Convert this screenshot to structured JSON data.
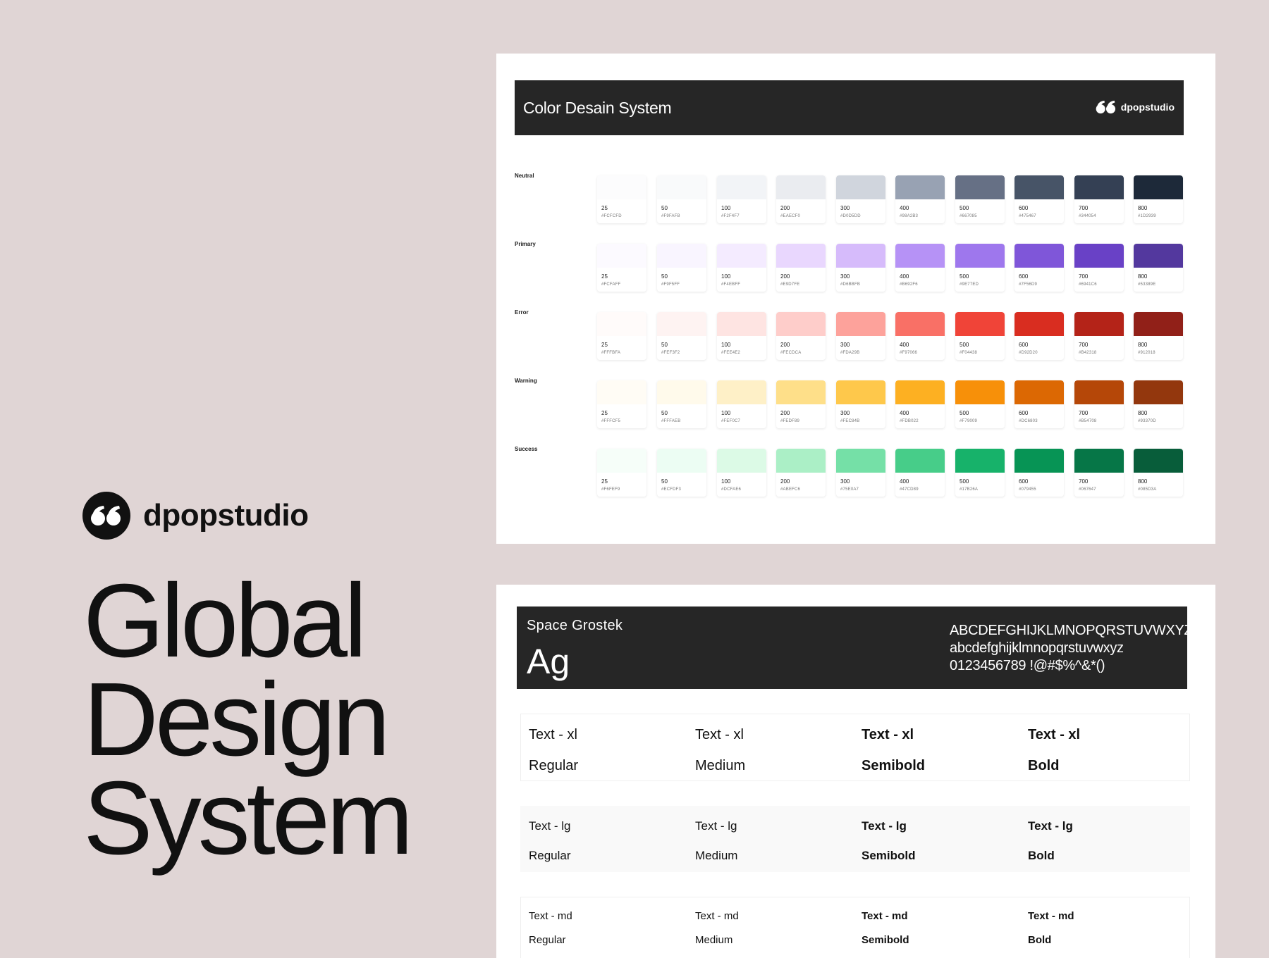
{
  "brand": {
    "name": "dpopstudio"
  },
  "hero": {
    "line1": "Global",
    "line2": "Design",
    "line3": "System"
  },
  "color_system": {
    "title": "Color Desain System",
    "brand_label": "dpopstudio",
    "steps": [
      "25",
      "50",
      "100",
      "200",
      "300",
      "400",
      "500",
      "600",
      "700",
      "800"
    ],
    "rows": [
      {
        "label": "Neutral",
        "hex_labels": [
          "#FCFCFD",
          "#F9FAFB",
          "#F2F4F7",
          "#EAECF0",
          "#D0D5DD",
          "#98A2B3",
          "#667085",
          "#475467",
          "#344054",
          "#1D2939"
        ],
        "colors": [
          "#FCFCFD",
          "#F9FAFB",
          "#F2F4F7",
          "#EAECF0",
          "#D0D5DD",
          "#98A2B3",
          "#667085",
          "#475467",
          "#344054",
          "#1D2939"
        ]
      },
      {
        "label": "Primary",
        "hex_labels": [
          "#FCFAFF",
          "#F9F5FF",
          "#F4EBFF",
          "#E9D7FE",
          "#D6BBFB",
          "#B692F6",
          "#9E77ED",
          "#7F56D9",
          "#6941C6",
          "#53389E"
        ],
        "colors": [
          "#FCFAFF",
          "#F9F5FF",
          "#F4EBFF",
          "#E9D7FE",
          "#D6BBFB",
          "#B692F6",
          "#9E77ED",
          "#7F56D9",
          "#6941C6",
          "#53389E"
        ]
      },
      {
        "label": "Error",
        "hex_labels": [
          "#FFFBFA",
          "#FEF3F2",
          "#FEE4E2",
          "#FECDCA",
          "#FDA29B",
          "#F97066",
          "#F04438",
          "#D92D20",
          "#B42318",
          "#912018"
        ],
        "colors": [
          "#FFFBFA",
          "#FEF3F2",
          "#FEE4E2",
          "#FECDCA",
          "#FDA29B",
          "#F97066",
          "#F04438",
          "#D92D20",
          "#B42318",
          "#912018"
        ]
      },
      {
        "label": "Warning",
        "hex_labels": [
          "#FFFCF5",
          "#FFFAEB",
          "#FEF0C7",
          "#FEDF89",
          "#FEC84B",
          "#FDB022",
          "#F79009",
          "#DC6803",
          "#B54708",
          "#93370D"
        ],
        "colors": [
          "#FFFCF5",
          "#FFFAEB",
          "#FEF0C7",
          "#FEDF89",
          "#FEC84B",
          "#FDB022",
          "#F79009",
          "#DC6803",
          "#B54708",
          "#93370D"
        ]
      },
      {
        "label": "Success",
        "hex_labels": [
          "#F6FEF9",
          "#ECFDF3",
          "#DCFAE6",
          "#ABEFC6",
          "#75E0A7",
          "#47CD89",
          "#17B26A",
          "#079455",
          "#067647",
          "#085D3A"
        ],
        "colors": [
          "#F6FEF9",
          "#ECFDF3",
          "#DCFAE6",
          "#ABEFC6",
          "#75E0A7",
          "#47CD89",
          "#17B26A",
          "#079455",
          "#067647",
          "#085D3A"
        ]
      }
    ]
  },
  "typography": {
    "font_name": "Space Grostek",
    "sample": "Ag",
    "uppercase": "ABCDEFGHIJKLMNOPQRSTUVWXYZ",
    "lowercase": "abcdefghijklmnopqrstuvwxyz",
    "symbols": "0123456789 !@#$%^&*()",
    "rows": [
      {
        "names": [
          "Text - xl",
          "Text - xl",
          "Text - xl",
          "Text - xl"
        ],
        "weights": [
          "Regular",
          "Medium",
          "Semibold",
          "Bold"
        ]
      },
      {
        "names": [
          "Text -  lg",
          "Text -  lg",
          "Text -  lg",
          "Text - lg"
        ],
        "weights": [
          "Regular",
          "Medium",
          "Semibold",
          "Bold"
        ]
      },
      {
        "names": [
          "Text -  md",
          "Text -  md",
          "Text -  md",
          "Text -  md"
        ],
        "weights": [
          "Regular",
          "Medium",
          "Semibold",
          "Bold"
        ]
      }
    ]
  }
}
